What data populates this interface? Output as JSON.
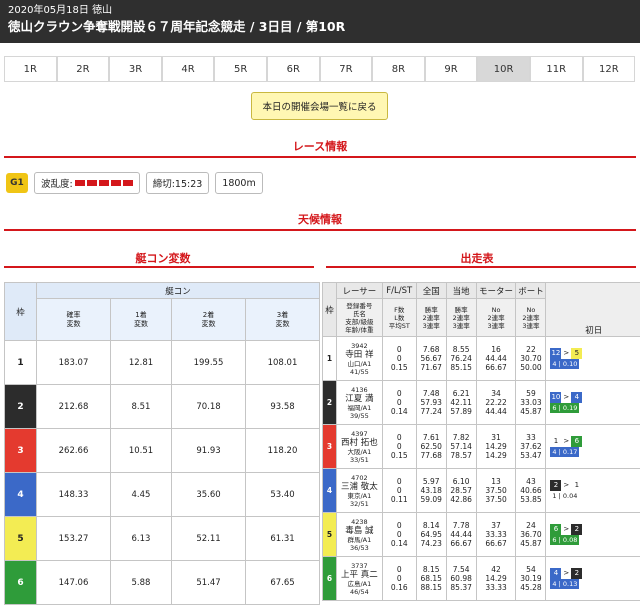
{
  "header": {
    "date": "2020年05月18日 徳山",
    "title": "徳山クラウン争奪戦開設６７周年記念競走 / 3日目 / 第10R"
  },
  "tabs": [
    "1R",
    "2R",
    "3R",
    "4R",
    "5R",
    "6R",
    "7R",
    "8R",
    "9R",
    "10R",
    "11R",
    "12R"
  ],
  "active_tab": "10R",
  "back_button": "本日の開催会場一覧に戻る",
  "race_info_title": "レース情報",
  "grade": "G1",
  "wave_label": "波乱度:",
  "deadline": "締切:15:23",
  "distance": "1800m",
  "weather_title": "天候情報",
  "kyotei_title": "艇コン変数",
  "entry_title": "出走表",
  "kt": {
    "h_lane": "枠",
    "h_group": "艇コン",
    "h1": "確率\n変数",
    "h2": "1着\n変数",
    "h3": "2着\n変数",
    "h4": "3着\n変数",
    "rows": [
      [
        "1",
        "183.07",
        "12.81",
        "199.55",
        "108.01"
      ],
      [
        "2",
        "212.68",
        "8.51",
        "70.18",
        "93.58"
      ],
      [
        "3",
        "262.66",
        "10.51",
        "91.93",
        "118.20"
      ],
      [
        "4",
        "148.33",
        "4.45",
        "35.60",
        "53.40"
      ],
      [
        "5",
        "153.27",
        "6.13",
        "52.11",
        "61.31"
      ],
      [
        "6",
        "147.06",
        "5.88",
        "51.47",
        "67.65"
      ]
    ]
  },
  "rt": {
    "h_lane": "枠",
    "h_racer": "レーサー",
    "h_flst": "F/L/ST",
    "h_zen": "全国",
    "h_toch": "当地",
    "h_motor": "モーター",
    "h_boat": "ボート",
    "s_racer": "登録番号\n氏名\n支部/級級\n年齢/体重",
    "s_flst": "F数\nL数\n平均ST",
    "s_zen": "勝率\n2連率\n3連率",
    "s_toch": "勝率\n2連率\n3連率",
    "s_motor": "No\n2連率\n3連率",
    "s_boat": "No\n2連率\n3連率",
    "day1": "初日",
    "rows": [
      {
        "lane": "1",
        "id": "3942",
        "name": "寺田 祥",
        "branch": "山口/A1",
        "age": "41/55",
        "flst": [
          "0",
          "0",
          "0.15"
        ],
        "zen": [
          "7.68",
          "56.67",
          "71.67"
        ],
        "toch": [
          "8.55",
          "76.24",
          "85.15"
        ],
        "motor": [
          "16",
          "44.44",
          "66.67"
        ],
        "boat": [
          "22",
          "30.70",
          "50.00"
        ],
        "r1": "12",
        "r1b": "5",
        "st": "4 | 0.10"
      },
      {
        "lane": "2",
        "id": "4136",
        "name": "江夏 満",
        "branch": "福岡/A1",
        "age": "39/55",
        "flst": [
          "0",
          "0",
          "0.14"
        ],
        "zen": [
          "7.48",
          "57.93",
          "77.24"
        ],
        "toch": [
          "6.21",
          "42.11",
          "57.89"
        ],
        "motor": [
          "34",
          "22.22",
          "44.44"
        ],
        "boat": [
          "59",
          "33.03",
          "45.87"
        ],
        "r1": "10",
        "r1b": "4",
        "st": "6 | 0.19"
      },
      {
        "lane": "3",
        "id": "4397",
        "name": "西村 拓也",
        "branch": "大阪/A1",
        "age": "33/51",
        "flst": [
          "0",
          "0",
          "0.15"
        ],
        "zen": [
          "7.61",
          "62.50",
          "77.68"
        ],
        "toch": [
          "7.82",
          "57.14",
          "78.57"
        ],
        "motor": [
          "31",
          "14.29",
          "14.29"
        ],
        "boat": [
          "33",
          "37.62",
          "53.47"
        ],
        "r1": "1",
        "r1b": "6",
        "st": "4 | 0.17"
      },
      {
        "lane": "4",
        "id": "4702",
        "name": "三浦 敬太",
        "branch": "東京/A1",
        "age": "32/51",
        "flst": [
          "0",
          "0",
          "0.11"
        ],
        "zen": [
          "5.97",
          "43.18",
          "59.09"
        ],
        "toch": [
          "6.10",
          "28.57",
          "42.86"
        ],
        "motor": [
          "13",
          "37.50",
          "37.50"
        ],
        "boat": [
          "43",
          "40.66",
          "53.85"
        ],
        "r1": "2",
        "r1b": "1",
        "st": "1 | 0.04"
      },
      {
        "lane": "5",
        "id": "4238",
        "name": "毒島 誠",
        "branch": "群馬/A1",
        "age": "36/53",
        "flst": [
          "0",
          "0",
          "0.14"
        ],
        "zen": [
          "8.14",
          "64.95",
          "74.23"
        ],
        "toch": [
          "7.78",
          "44.44",
          "66.67"
        ],
        "motor": [
          "37",
          "33.33",
          "66.67"
        ],
        "boat": [
          "24",
          "36.70",
          "45.87"
        ],
        "r1": "6",
        "r1b": "2",
        "st": "6 | 0.08"
      },
      {
        "lane": "6",
        "id": "3737",
        "name": "上平 真二",
        "branch": "広島/A1",
        "age": "46/54",
        "flst": [
          "0",
          "0",
          "0.16"
        ],
        "zen": [
          "8.15",
          "68.15",
          "88.15"
        ],
        "toch": [
          "7.54",
          "60.98",
          "85.37"
        ],
        "motor": [
          "42",
          "14.29",
          "33.33"
        ],
        "boat": [
          "54",
          "30.19",
          "45.28"
        ],
        "r1": "4",
        "r1b": "2",
        "st": "4 | 0.13"
      }
    ]
  }
}
